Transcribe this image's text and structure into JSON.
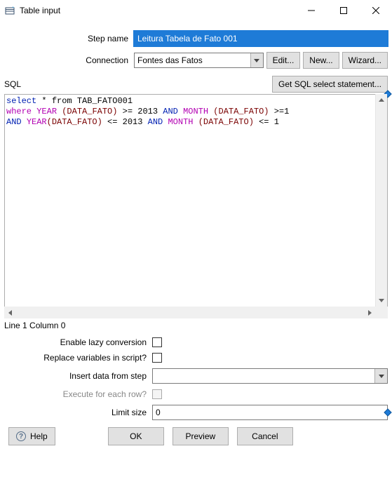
{
  "window": {
    "title": "Table input"
  },
  "form": {
    "stepName": {
      "label": "Step name",
      "value": "Leitura Tabela de Fato 001"
    },
    "connection": {
      "label": "Connection",
      "value": "Fontes das Fatos"
    },
    "editBtn": "Edit...",
    "newBtn": "New...",
    "wizardBtn": "Wizard..."
  },
  "sql": {
    "label": "SQL",
    "getStatementBtn": "Get SQL select statement...",
    "statusLine": "Line 1 Column 0",
    "script": {
      "line1": {
        "select": "select",
        "star_from": " * from ",
        "table": "TAB_FATO001"
      },
      "line2": {
        "where": "where",
        "sp1": " ",
        "year": "YEAR",
        "sp2": " ",
        "p1": "(DATA_FATO)",
        "gte": " >= 2013 ",
        "and1": "AND",
        "sp3": " ",
        "month": "MONTH",
        "sp4": " ",
        "p2": "(DATA_FATO)",
        "tail": " >=1"
      },
      "line3": {
        "and": "AND",
        "sp1": " ",
        "year": "YEAR",
        "p1": "(DATA_FATO)",
        "lte": " <= 2013 ",
        "and2": "AND",
        "sp2": " ",
        "month": "MONTH",
        "sp3": " ",
        "p2": "(DATA_FATO)",
        "tail": " <= 1"
      }
    }
  },
  "options": {
    "lazy": {
      "label": "Enable lazy conversion"
    },
    "replaceVars": {
      "label": "Replace variables in script?"
    },
    "insertFrom": {
      "label": "Insert data from step",
      "value": ""
    },
    "eachRow": {
      "label": "Execute for each row?"
    },
    "limitSize": {
      "label": "Limit size",
      "value": "0"
    }
  },
  "buttons": {
    "help": "Help",
    "ok": "OK",
    "preview": "Preview",
    "cancel": "Cancel"
  }
}
